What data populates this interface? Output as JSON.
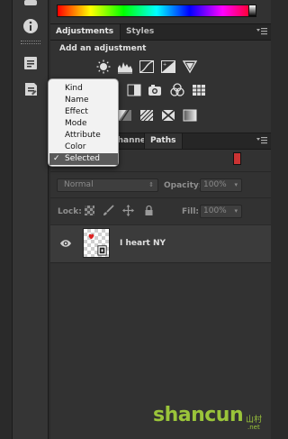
{
  "adjustments_panel": {
    "tabs": [
      "Adjustments",
      "Styles"
    ],
    "heading": "Add an adjustment"
  },
  "layers_panel": {
    "tabs": [
      "Channels",
      "Paths"
    ],
    "blend_mode": "Normal",
    "opacity_label": "Opacity:",
    "opacity_value": "100%",
    "lock_label": "Lock:",
    "fill_label": "Fill:",
    "fill_value": "100%",
    "layer_name": "I heart NY"
  },
  "filter_menu": {
    "items": [
      "Kind",
      "Name",
      "Effect",
      "Mode",
      "Attribute",
      "Color",
      "Selected"
    ],
    "selected": "Selected",
    "check": "✓"
  },
  "watermark": {
    "main": "shancun",
    "cjk": "山村",
    "sub": ".net"
  },
  "colors": {
    "filter_swatch": "#cc3333",
    "menu_selection": "#5a5a5a",
    "watermark": "#9ac43a"
  }
}
